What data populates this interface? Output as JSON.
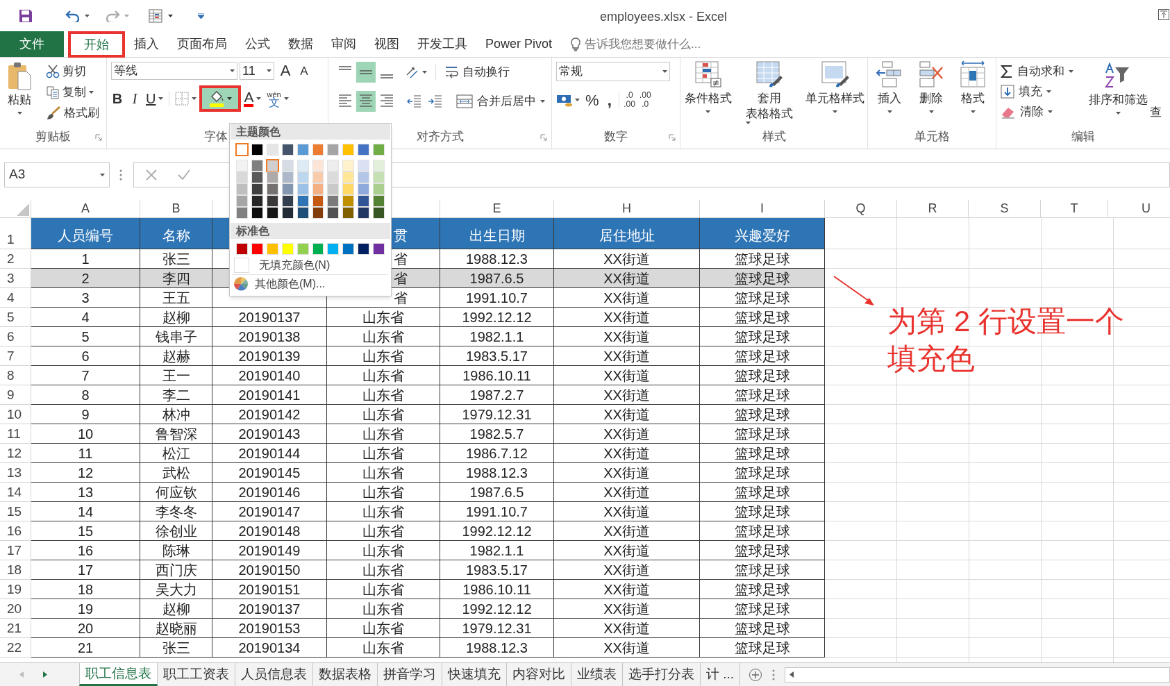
{
  "title_bar": {
    "title": "employees.xlsx - Excel"
  },
  "tabs": [
    {
      "label": "文件",
      "kind": "file",
      "selected": false,
      "highlighted": false
    },
    {
      "label": "开始",
      "kind": "tab",
      "selected": true,
      "highlighted": true
    },
    {
      "label": "插入",
      "kind": "tab",
      "selected": false,
      "highlighted": false
    },
    {
      "label": "页面布局",
      "kind": "tab",
      "selected": false,
      "highlighted": false
    },
    {
      "label": "公式",
      "kind": "tab",
      "selected": false,
      "highlighted": false
    },
    {
      "label": "数据",
      "kind": "tab",
      "selected": false,
      "highlighted": false
    },
    {
      "label": "审阅",
      "kind": "tab",
      "selected": false,
      "highlighted": false
    },
    {
      "label": "视图",
      "kind": "tab",
      "selected": false,
      "highlighted": false
    },
    {
      "label": "开发工具",
      "kind": "tab",
      "selected": false,
      "highlighted": false
    },
    {
      "label": "Power Pivot",
      "kind": "tab",
      "selected": false,
      "highlighted": false
    }
  ],
  "tell_me": {
    "placeholder": "告诉我您想要做什么..."
  },
  "clipboard": {
    "paste": "粘贴",
    "cut": "剪切",
    "copy": "复制",
    "format_painter": "格式刷",
    "label": "剪贴板"
  },
  "font": {
    "name": "等线",
    "size": "11",
    "grow": "A",
    "shrink": "A",
    "bold": "B",
    "italic": "I",
    "underline": "U",
    "font_color": "A",
    "phonetic_top": "wén",
    "phonetic_bottom": "文",
    "fill_highlighted": true,
    "label": "字体"
  },
  "alignment": {
    "vertical": [
      {
        "selected": false
      },
      {
        "selected": true
      },
      {
        "selected": false
      }
    ],
    "horizontal": [
      {
        "selected": false
      },
      {
        "selected": true
      },
      {
        "selected": false
      }
    ],
    "wrap": "自动换行",
    "merge": "合并后居中",
    "label": "对齐方式"
  },
  "number": {
    "format": "常规",
    "percent": "%",
    "comma": ",",
    "decimal_increase": [
      ".0",
      ".00"
    ],
    "decimal_decrease": [
      ".00",
      ".0"
    ],
    "label": "数字"
  },
  "styles": {
    "conditional": "条件格式",
    "table_format": [
      "套用",
      "表格格式"
    ],
    "cell_styles": "单元格样式",
    "label": "样式"
  },
  "cells": {
    "insert": "插入",
    "delete": "删除",
    "format": "格式",
    "label": "单元格"
  },
  "editing": {
    "autosum": "自动求和",
    "fill": "填充",
    "clear": "清除",
    "sort_filter": "排序和筛选",
    "find": "查",
    "label": "编辑"
  },
  "formula_bar": {
    "name_box": "A3"
  },
  "column_headers": {
    "A": "A",
    "B": "B",
    "E": "E",
    "H": "H",
    "I": "I",
    "Q": "Q",
    "R": "R",
    "S": "S",
    "T": "T",
    "U": "U"
  },
  "rows": [
    {
      "number": "1",
      "kind": "header",
      "cells": {
        "A": "人员编号",
        "B": "名称",
        "D": "贯",
        "E": "出生日期",
        "H": "居住地址",
        "I": "兴趣爱好"
      }
    },
    {
      "number": "2",
      "kind": "data",
      "selected": false,
      "cells": {
        "A": "1",
        "B": "张三",
        "D": "省",
        "E": "1988.12.3",
        "H": "XX街道",
        "I": "篮球足球"
      }
    },
    {
      "number": "3",
      "kind": "data",
      "selected": true,
      "cells": {
        "A": "2",
        "B": "李四",
        "D": "省",
        "E": "1987.6.5",
        "H": "XX街道",
        "I": "篮球足球"
      }
    },
    {
      "number": "4",
      "kind": "data",
      "selected": false,
      "cells": {
        "A": "3",
        "B": "王五",
        "D": "省",
        "E": "1991.10.7",
        "H": "XX街道",
        "I": "篮球足球"
      }
    },
    {
      "number": "5",
      "kind": "data",
      "selected": false,
      "cells": {
        "A": "4",
        "B": "赵柳",
        "C": "20190137",
        "D": "山东省",
        "E": "1992.12.12",
        "H": "XX街道",
        "I": "篮球足球"
      }
    },
    {
      "number": "6",
      "kind": "data",
      "selected": false,
      "cells": {
        "A": "5",
        "B": "钱串子",
        "C": "20190138",
        "D": "山东省",
        "E": "1982.1.1",
        "H": "XX街道",
        "I": "篮球足球"
      }
    },
    {
      "number": "7",
      "kind": "data",
      "selected": false,
      "cells": {
        "A": "6",
        "B": "赵赫",
        "C": "20190139",
        "D": "山东省",
        "E": "1983.5.17",
        "H": "XX街道",
        "I": "篮球足球"
      }
    },
    {
      "number": "8",
      "kind": "data",
      "selected": false,
      "cells": {
        "A": "7",
        "B": "王一",
        "C": "20190140",
        "D": "山东省",
        "E": "1986.10.11",
        "H": "XX街道",
        "I": "篮球足球"
      }
    },
    {
      "number": "9",
      "kind": "data",
      "selected": false,
      "cells": {
        "A": "8",
        "B": "李二",
        "C": "20190141",
        "D": "山东省",
        "E": "1987.2.7",
        "H": "XX街道",
        "I": "篮球足球"
      }
    },
    {
      "number": "10",
      "kind": "data",
      "selected": false,
      "cells": {
        "A": "9",
        "B": "林冲",
        "C": "20190142",
        "D": "山东省",
        "E": "1979.12.31",
        "H": "XX街道",
        "I": "篮球足球"
      }
    },
    {
      "number": "11",
      "kind": "data",
      "selected": false,
      "cells": {
        "A": "10",
        "B": "鲁智深",
        "C": "20190143",
        "D": "山东省",
        "E": "1982.5.7",
        "H": "XX街道",
        "I": "篮球足球"
      }
    },
    {
      "number": "12",
      "kind": "data",
      "selected": false,
      "cells": {
        "A": "11",
        "B": "松江",
        "C": "20190144",
        "D": "山东省",
        "E": "1986.7.12",
        "H": "XX街道",
        "I": "篮球足球"
      }
    },
    {
      "number": "13",
      "kind": "data",
      "selected": false,
      "cells": {
        "A": "12",
        "B": "武松",
        "C": "20190145",
        "D": "山东省",
        "E": "1988.12.3",
        "H": "XX街道",
        "I": "篮球足球"
      }
    },
    {
      "number": "14",
      "kind": "data",
      "selected": false,
      "cells": {
        "A": "13",
        "B": "何应钦",
        "C": "20190146",
        "D": "山东省",
        "E": "1987.6.5",
        "H": "XX街道",
        "I": "篮球足球"
      }
    },
    {
      "number": "15",
      "kind": "data",
      "selected": false,
      "cells": {
        "A": "14",
        "B": "李冬冬",
        "C": "20190147",
        "D": "山东省",
        "E": "1991.10.7",
        "H": "XX街道",
        "I": "篮球足球"
      }
    },
    {
      "number": "16",
      "kind": "data",
      "selected": false,
      "cells": {
        "A": "15",
        "B": "徐创业",
        "C": "20190148",
        "D": "山东省",
        "E": "1992.12.12",
        "H": "XX街道",
        "I": "篮球足球"
      }
    },
    {
      "number": "17",
      "kind": "data",
      "selected": false,
      "cells": {
        "A": "16",
        "B": "陈琳",
        "C": "20190149",
        "D": "山东省",
        "E": "1982.1.1",
        "H": "XX街道",
        "I": "篮球足球"
      }
    },
    {
      "number": "18",
      "kind": "data",
      "selected": false,
      "cells": {
        "A": "17",
        "B": "西门庆",
        "C": "20190150",
        "D": "山东省",
        "E": "1983.5.17",
        "H": "XX街道",
        "I": "篮球足球"
      }
    },
    {
      "number": "19",
      "kind": "data",
      "selected": false,
      "cells": {
        "A": "18",
        "B": "吴大力",
        "C": "20190151",
        "D": "山东省",
        "E": "1986.10.11",
        "H": "XX街道",
        "I": "篮球足球"
      }
    },
    {
      "number": "20",
      "kind": "data",
      "selected": false,
      "cells": {
        "A": "19",
        "B": "赵柳",
        "C": "20190137",
        "D": "山东省",
        "E": "1992.12.12",
        "H": "XX街道",
        "I": "篮球足球"
      }
    },
    {
      "number": "21",
      "kind": "data",
      "selected": false,
      "cells": {
        "A": "20",
        "B": "赵晓丽",
        "C": "20190153",
        "D": "山东省",
        "E": "1979.12.31",
        "H": "XX街道",
        "I": "篮球足球"
      }
    },
    {
      "number": "22",
      "kind": "data",
      "selected": false,
      "cells": {
        "A": "21",
        "B": "张三",
        "C": "20190134",
        "D": "山东省",
        "E": "1988.12.3",
        "H": "XX街道",
        "I": "篮球足球"
      }
    }
  ],
  "fill_menu": {
    "theme_title": "主题颜色",
    "theme_rows": [
      [
        {
          "color": "#ffffff",
          "selected": true
        },
        {
          "color": "#000000",
          "selected": false
        },
        {
          "color": "#e7e6e6",
          "selected": false
        },
        {
          "color": "#44546a",
          "selected": false
        },
        {
          "color": "#5b9bd5",
          "selected": false
        },
        {
          "color": "#ed7d31",
          "selected": false
        },
        {
          "color": "#a5a5a5",
          "selected": false
        },
        {
          "color": "#ffc000",
          "selected": false
        },
        {
          "color": "#4472c4",
          "selected": false
        },
        {
          "color": "#70ad47",
          "selected": false
        }
      ],
      [
        {
          "color": "#f2f2f2",
          "selected": false
        },
        {
          "color": "#7f7f7f",
          "selected": false
        },
        {
          "color": "#d0cece",
          "selected": true
        },
        {
          "color": "#d6dce4",
          "selected": false
        },
        {
          "color": "#ddebf7",
          "selected": false
        },
        {
          "color": "#fce4d6",
          "selected": false
        },
        {
          "color": "#ededed",
          "selected": false
        },
        {
          "color": "#fff2cc",
          "selected": false
        },
        {
          "color": "#d9e1f2",
          "selected": false
        },
        {
          "color": "#e2efda",
          "selected": false
        }
      ],
      [
        {
          "color": "#d9d9d9",
          "selected": false
        },
        {
          "color": "#595959",
          "selected": false
        },
        {
          "color": "#aeaaaa",
          "selected": false
        },
        {
          "color": "#adb9ca",
          "selected": false
        },
        {
          "color": "#bdd7ee",
          "selected": false
        },
        {
          "color": "#f8cbad",
          "selected": false
        },
        {
          "color": "#dbdbdb",
          "selected": false
        },
        {
          "color": "#ffe699",
          "selected": false
        },
        {
          "color": "#b4c6e7",
          "selected": false
        },
        {
          "color": "#c6e0b4",
          "selected": false
        }
      ],
      [
        {
          "color": "#bfbfbf",
          "selected": false
        },
        {
          "color": "#404040",
          "selected": false
        },
        {
          "color": "#757171",
          "selected": false
        },
        {
          "color": "#8497b0",
          "selected": false
        },
        {
          "color": "#9bc2e6",
          "selected": false
        },
        {
          "color": "#f4b084",
          "selected": false
        },
        {
          "color": "#c9c9c9",
          "selected": false
        },
        {
          "color": "#ffd966",
          "selected": false
        },
        {
          "color": "#8ea9db",
          "selected": false
        },
        {
          "color": "#a9d08e",
          "selected": false
        }
      ],
      [
        {
          "color": "#a6a6a6",
          "selected": false
        },
        {
          "color": "#262626",
          "selected": false
        },
        {
          "color": "#3a3838",
          "selected": false
        },
        {
          "color": "#333f4f",
          "selected": false
        },
        {
          "color": "#2f75b5",
          "selected": false
        },
        {
          "color": "#c65911",
          "selected": false
        },
        {
          "color": "#7b7b7b",
          "selected": false
        },
        {
          "color": "#bf8f00",
          "selected": false
        },
        {
          "color": "#305496",
          "selected": false
        },
        {
          "color": "#548235",
          "selected": false
        }
      ],
      [
        {
          "color": "#808080",
          "selected": false
        },
        {
          "color": "#0d0d0d",
          "selected": false
        },
        {
          "color": "#161616",
          "selected": false
        },
        {
          "color": "#222b35",
          "selected": false
        },
        {
          "color": "#1f4e78",
          "selected": false
        },
        {
          "color": "#833c0c",
          "selected": false
        },
        {
          "color": "#525252",
          "selected": false
        },
        {
          "color": "#806000",
          "selected": false
        },
        {
          "color": "#203764",
          "selected": false
        },
        {
          "color": "#375623",
          "selected": false
        }
      ]
    ],
    "standard_title": "标准色",
    "standard": [
      {
        "color": "#c00000",
        "selected": false
      },
      {
        "color": "#ff0000",
        "selected": false
      },
      {
        "color": "#ffc000",
        "selected": false
      },
      {
        "color": "#ffff00",
        "selected": false
      },
      {
        "color": "#92d050",
        "selected": false
      },
      {
        "color": "#00b050",
        "selected": false
      },
      {
        "color": "#00b0f0",
        "selected": false
      },
      {
        "color": "#0070c0",
        "selected": false
      },
      {
        "color": "#002060",
        "selected": false
      },
      {
        "color": "#7030a0",
        "selected": false
      }
    ],
    "no_fill": "无填充颜色(N)",
    "more": "其他颜色(M)..."
  },
  "annotation": {
    "text": "为第 2 行设置一个填充色"
  },
  "sheet_tabs": [
    {
      "label": "职工信息表",
      "selected": true
    },
    {
      "label": "职工工资表",
      "selected": false
    },
    {
      "label": "人员信息表",
      "selected": false
    },
    {
      "label": "数据表格",
      "selected": false
    },
    {
      "label": "拼音学习",
      "selected": false
    },
    {
      "label": "快速填充",
      "selected": false
    },
    {
      "label": "内容对比",
      "selected": false
    },
    {
      "label": "业绩表",
      "selected": false
    },
    {
      "label": "选手打分表",
      "selected": false
    },
    {
      "label": "计 ...",
      "selected": false
    }
  ]
}
